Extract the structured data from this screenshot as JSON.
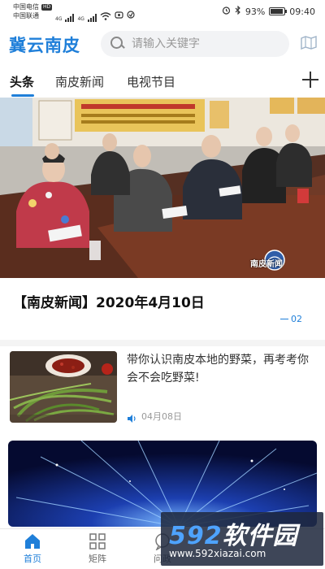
{
  "status_bar": {
    "carrier_1": "中国电信",
    "carrier_1_badge": "HD",
    "carrier_2": "中国联通",
    "net_label_1": "4G",
    "net_label_2": "4G",
    "battery_percent": "93%",
    "battery_level": 0.93,
    "time": "09:40"
  },
  "header": {
    "app_title": "冀云南皮",
    "search_placeholder": "请输入关键字",
    "search_icon": "search-icon",
    "map_icon": "map-icon",
    "brand_color": "#1f7fd9"
  },
  "tabs": {
    "items": [
      {
        "label": "头条",
        "active": true
      },
      {
        "label": "南皮新闻",
        "active": false
      },
      {
        "label": "电视节目",
        "active": false
      }
    ],
    "add_icon": "plus-icon"
  },
  "hero": {
    "title": "【南皮新闻】2020年4月10日",
    "video_logo": "南皮新闻",
    "page_indicator": "02"
  },
  "news": [
    {
      "title": "带你认识南皮本地的野菜，再考考你会不会吃野菜!",
      "date": "04月08日",
      "audio_icon": "volume-icon"
    }
  ],
  "bottom_nav": {
    "items": [
      {
        "label": "首页",
        "icon": "home-icon",
        "active": true
      },
      {
        "label": "矩阵",
        "icon": "grid-icon",
        "active": false
      },
      {
        "label": "问政",
        "icon": "chat-icon",
        "active": false
      }
    ]
  },
  "watermark": {
    "brand_num": "592",
    "brand_text": "软件园",
    "url": "www.592xiazai.com"
  }
}
